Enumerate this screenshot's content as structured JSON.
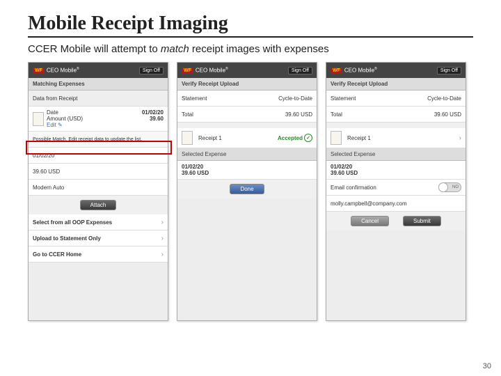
{
  "title": "Mobile Receipt Imaging",
  "subtitle_pre": "CCER Mobile will attempt to ",
  "subtitle_em": "match",
  "subtitle_post": " receipt images with expenses",
  "page_number": "30",
  "header": {
    "brand": "CEO Mobile",
    "signoff": "Sign Off",
    "wf": "WF"
  },
  "screen1": {
    "sec1": "Matching Expenses",
    "sub1": "Data from Receipt",
    "date_label": "Date",
    "date_val": "01/02/20",
    "amt_label": "Amount (USD)",
    "amt_val": "39.60",
    "edit": "Edit ✎",
    "match_msg": "Possible Match. Edit receipt data to update the list.",
    "exp_date": "01/02/20",
    "exp_amt": "39.60 USD",
    "vendor": "Modern Auto",
    "attach": "Attach",
    "opt1": "Select from all OOP Expenses",
    "opt2": "Upload to Statement Only",
    "opt3": "Go to CCER Home"
  },
  "screen2": {
    "title": "Verify Receipt Upload",
    "stmt": "Statement",
    "cycle": "Cycle-to-Date",
    "total_label": "Total",
    "total_val": "39.60 USD",
    "receipt": "Receipt 1",
    "accepted": "Accepted",
    "sel": "Selected Expense",
    "d": "01/02/20",
    "a": "39.60 USD",
    "done": "Done"
  },
  "screen3": {
    "title": "Verify Receipt Upload",
    "stmt": "Statement",
    "cycle": "Cycle-to-Date",
    "total_label": "Total",
    "total_val": "39.60 USD",
    "receipt": "Receipt 1",
    "sel": "Selected Expense",
    "d": "01/02/20",
    "a": "39.60 USD",
    "email_label": "Email confirmation",
    "email_tog": "NO",
    "email_val": "molly.campbell@company.com",
    "cancel": "Cancel",
    "submit": "Submit"
  }
}
